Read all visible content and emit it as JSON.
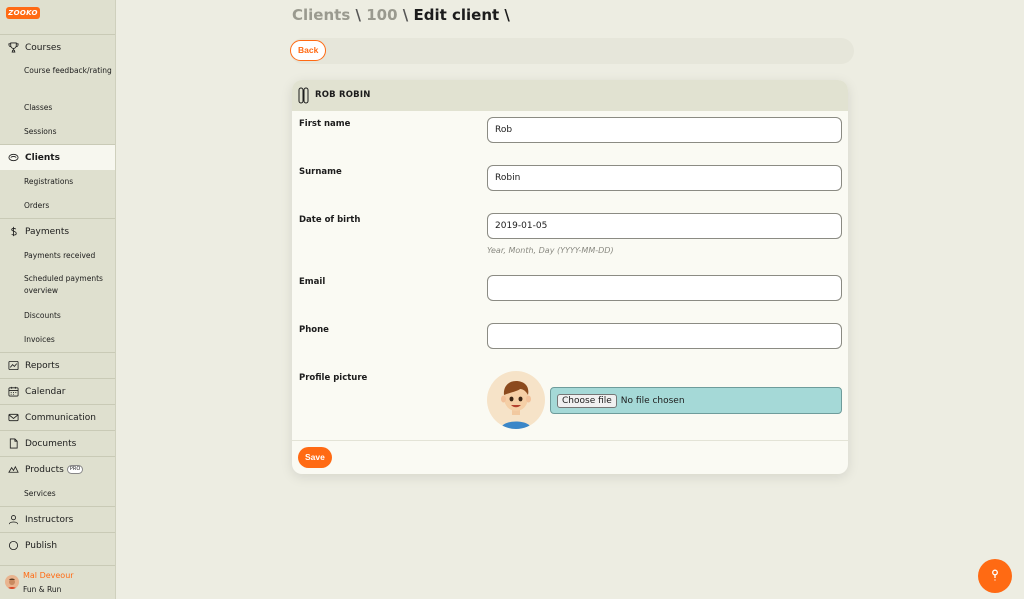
{
  "app": {
    "logo_text": "ZOOKO"
  },
  "sidebar": {
    "sections": [
      {
        "label": "Courses",
        "icon": "trophy-icon",
        "subs": [
          "Course feedback/rating",
          "Classes",
          "Sessions"
        ]
      },
      {
        "label": "Clients",
        "icon": "users-icon",
        "subs": [
          "Registrations",
          "Orders"
        ]
      },
      {
        "label": "Payments",
        "icon": "dollar-icon",
        "subs": [
          "Payments received",
          "Scheduled payments overview",
          "Discounts",
          "Invoices"
        ]
      },
      {
        "label": "Reports",
        "icon": "chart-icon"
      },
      {
        "label": "Calendar",
        "icon": "calendar-icon"
      },
      {
        "label": "Communication",
        "icon": "mail-icon"
      },
      {
        "label": "Documents",
        "icon": "document-icon"
      },
      {
        "label": "Products",
        "icon": "products-icon",
        "badge": "PRO",
        "subs": [
          "Services"
        ]
      },
      {
        "label": "Instructors",
        "icon": "person-icon"
      },
      {
        "label": "Publish",
        "icon": "publish-icon"
      }
    ],
    "user": {
      "name": "Mal Deveour",
      "org": "Fun & Run"
    }
  },
  "header": {
    "crumb_1": "Clients",
    "crumb_2": "100",
    "crumb_3": "Edit client",
    "separator": "\\"
  },
  "toolbar": {
    "back_label": "Back"
  },
  "card": {
    "title": "ROB ROBIN",
    "first_name_label": "First name",
    "first_name_value": "Rob",
    "surname_label": "Surname",
    "surname_value": "Robin",
    "dob_label": "Date of birth",
    "dob_value": "2019-01-05",
    "dob_hint": "Year, Month, Day (YYYY-MM-DD)",
    "email_label": "Email",
    "email_value": "",
    "phone_label": "Phone",
    "phone_value": "",
    "picture_label": "Profile picture",
    "choose_file_label": "Choose file",
    "no_file_label": "No file chosen",
    "save_label": "Save"
  },
  "colors": {
    "accent": "#ff6a13",
    "sidebar_bg": "#dfe0cf",
    "page_bg": "#edede2",
    "file_bg": "#a5d9d7"
  }
}
